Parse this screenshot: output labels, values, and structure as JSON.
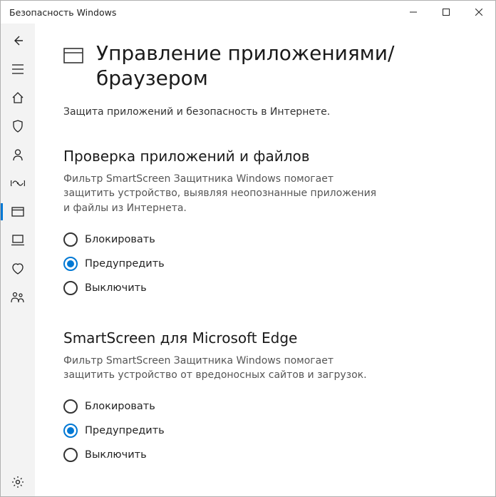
{
  "window": {
    "title": "Безопасность Windows"
  },
  "page": {
    "title": "Управление приложениями/браузером",
    "subtitle": "Защита приложений и безопасность в Интернете."
  },
  "sections": {
    "apps_files": {
      "title": "Проверка приложений и файлов",
      "desc": "Фильтр SmartScreen Защитника Windows помогает защитить устройство, выявляя неопознанные приложения и файлы из Интернета.",
      "options": {
        "block": "Блокировать",
        "warn": "Предупредить",
        "off": "Выключить"
      },
      "selected": "warn"
    },
    "edge": {
      "title": "SmartScreen для Microsoft Edge",
      "desc": "Фильтр SmartScreen Защитника Windows помогает защитить устройство от вредоносных сайтов и загрузок.",
      "options": {
        "block": "Блокировать",
        "warn": "Предупредить",
        "off": "Выключить"
      },
      "selected": "warn"
    }
  }
}
